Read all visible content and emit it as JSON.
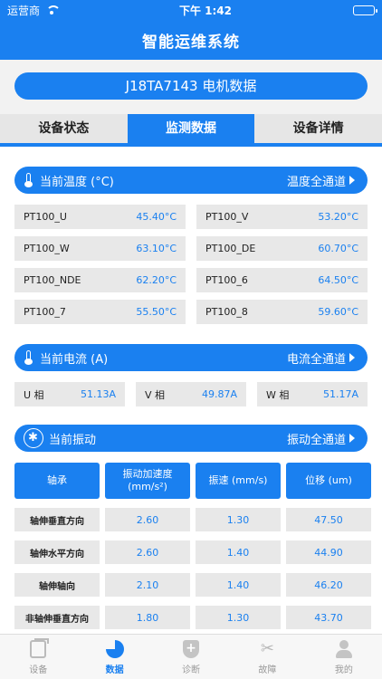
{
  "status_bar": {
    "carrier": "运营商",
    "time": "下午 1:42"
  },
  "app_title": "智能运维系统",
  "motor_title": "J18TA7143 电机数据",
  "tabs": [
    {
      "label": "设备状态",
      "active": false
    },
    {
      "label": "监测数据",
      "active": true
    },
    {
      "label": "设备详情",
      "active": false
    }
  ],
  "temperature": {
    "title": "当前温度 (°C)",
    "link": "温度全通道",
    "items": [
      {
        "name": "PT100_U",
        "value": "45.40°C"
      },
      {
        "name": "PT100_V",
        "value": "53.20°C"
      },
      {
        "name": "PT100_W",
        "value": "63.10°C"
      },
      {
        "name": "PT100_DE",
        "value": "60.70°C"
      },
      {
        "name": "PT100_NDE",
        "value": "62.20°C"
      },
      {
        "name": "PT100_6",
        "value": "64.50°C"
      },
      {
        "name": "PT100_7",
        "value": "55.50°C"
      },
      {
        "name": "PT100_8",
        "value": "59.60°C"
      }
    ]
  },
  "current": {
    "title": "当前电流 (A)",
    "link": "电流全通道",
    "items": [
      {
        "name": "U 相",
        "value": "51.13A"
      },
      {
        "name": "V 相",
        "value": "49.87A"
      },
      {
        "name": "W 相",
        "value": "51.17A"
      }
    ]
  },
  "vibration": {
    "title": "当前振动",
    "link": "振动全通道",
    "headers": [
      "轴承",
      "振动加速度",
      "(mm/s²)",
      "振速 (mm/s)",
      "位移 (um)"
    ],
    "rows": [
      {
        "name": "轴伸垂直方向",
        "acc": "2.60",
        "vel": "1.30",
        "disp": "47.50"
      },
      {
        "name": "轴伸水平方向",
        "acc": "2.60",
        "vel": "1.40",
        "disp": "44.90"
      },
      {
        "name": "轴伸轴向",
        "acc": "2.10",
        "vel": "1.40",
        "disp": "46.20"
      },
      {
        "name": "非轴伸垂直方向",
        "acc": "1.80",
        "vel": "1.30",
        "disp": "43.70"
      }
    ]
  },
  "tabbar": [
    {
      "label": "设备",
      "icon": "device-icon",
      "active": false
    },
    {
      "label": "数据",
      "icon": "pie-chart-icon",
      "active": true
    },
    {
      "label": "诊断",
      "icon": "diagnosis-shield-icon",
      "active": false
    },
    {
      "label": "故障",
      "icon": "tools-icon",
      "active": false
    },
    {
      "label": "我的",
      "icon": "user-icon",
      "active": false
    }
  ],
  "colors": {
    "primary": "#1a80f0",
    "cell_bg": "#e8e8e8",
    "value_text": "#1a80f0"
  }
}
